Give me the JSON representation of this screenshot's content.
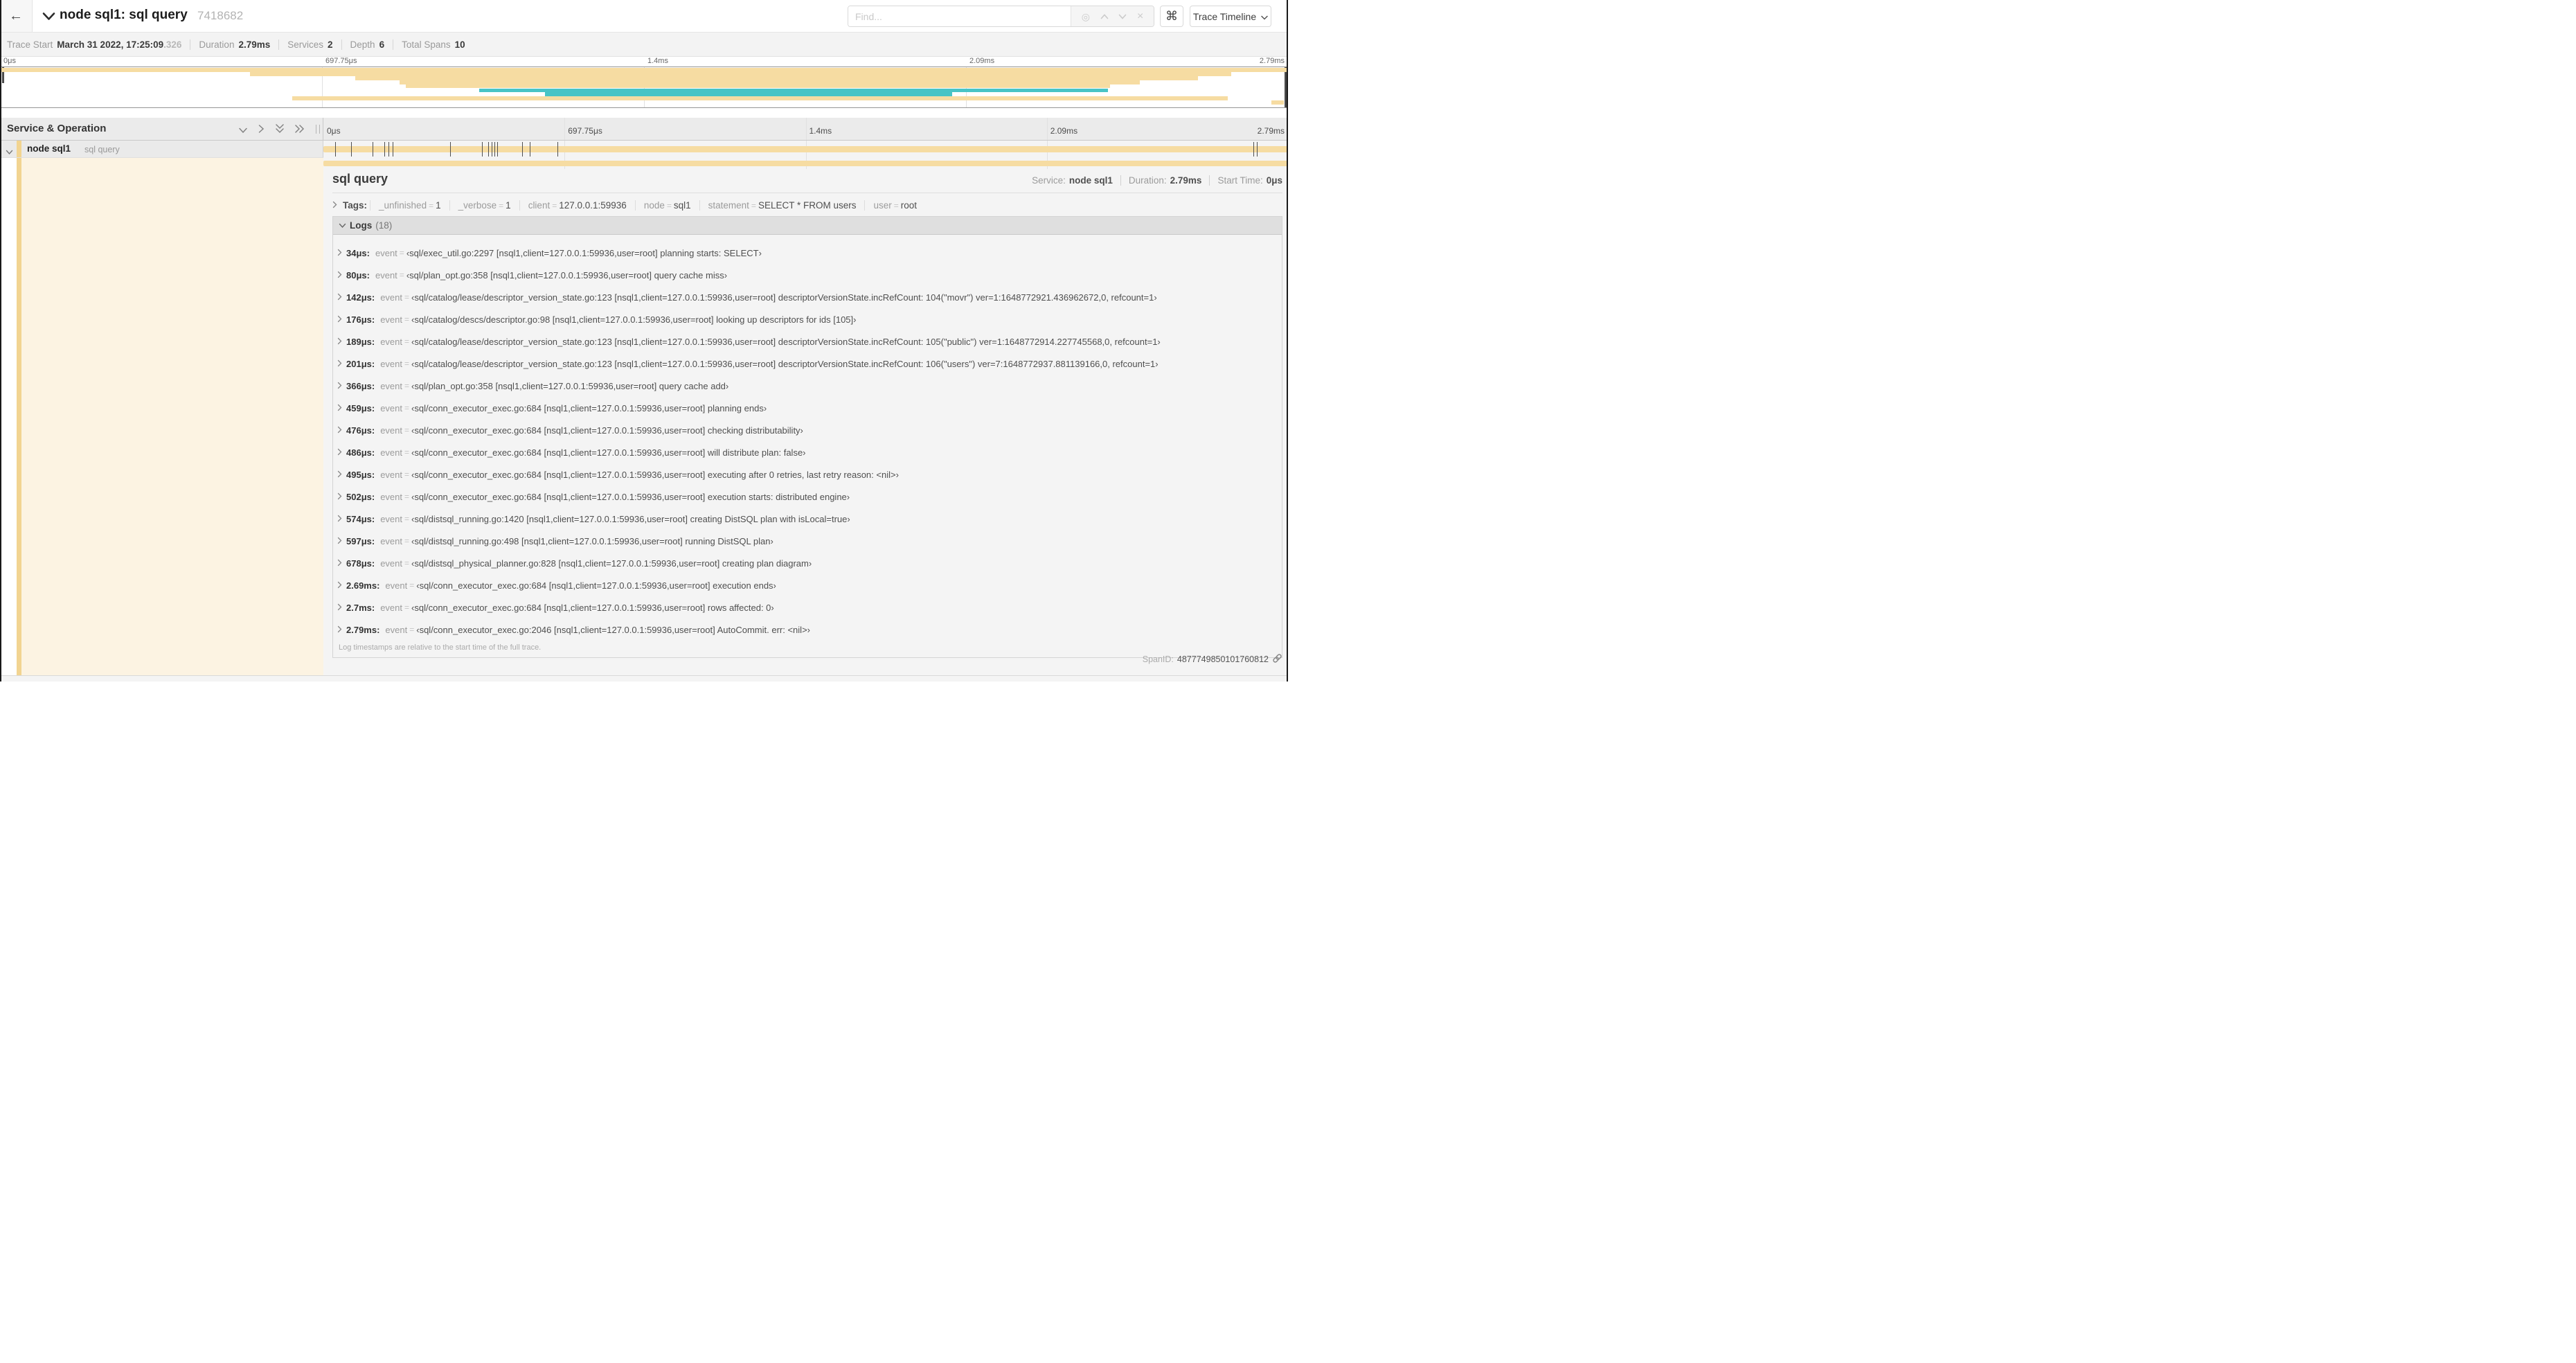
{
  "header": {
    "back_icon": "←",
    "title": "node sql1: sql query",
    "trace_id": "7418682",
    "find_placeholder": "Find...",
    "shortcuts_button": "⌘",
    "view_options_button": "Trace Timeline"
  },
  "summary": {
    "items": [
      {
        "label": "Trace Start",
        "value": "March 31 2022, 17:25:09",
        "suffix": ".326"
      },
      {
        "label": "Duration",
        "value": "2.79ms",
        "suffix": ""
      },
      {
        "label": "Services",
        "value": "2",
        "suffix": ""
      },
      {
        "label": "Depth",
        "value": "6",
        "suffix": ""
      },
      {
        "label": "Total Spans",
        "value": "10",
        "suffix": ""
      }
    ]
  },
  "colors": {
    "span_tan": "#f6dca2",
    "span_teal": "#48c4c6",
    "selected_row_cream": "#fcf3e2",
    "accent_stripe": "#f2d491"
  },
  "minimap": {
    "ticks": [
      "0μs",
      "697.75μs",
      "1.4ms",
      "2.09ms",
      "2.79ms"
    ],
    "spans": [
      {
        "start": 0.0,
        "end": 1.0,
        "color": "#f6dca2"
      },
      {
        "start": 0.194,
        "end": 0.956,
        "color": "#f6dca2"
      },
      {
        "start": 0.276,
        "end": 0.93,
        "color": "#f6dca2"
      },
      {
        "start": 0.31,
        "end": 0.885,
        "color": "#f6dca2"
      },
      {
        "start": 0.315,
        "end": 0.862,
        "color": "#f6dca2"
      },
      {
        "start": 0.372,
        "end": 0.86,
        "color": "#48c4c6"
      },
      {
        "start": 0.423,
        "end": 0.739,
        "color": "#48c4c6"
      },
      {
        "start": 0.227,
        "end": 0.953,
        "color": "#f6dca2"
      },
      {
        "start": 0.987,
        "end": 0.997,
        "color": "#f6dca2"
      }
    ]
  },
  "timeline": {
    "left_header": "Service & Operation",
    "ticks": [
      "0μs",
      "697.75μs",
      "1.4ms",
      "2.09ms",
      "2.79ms"
    ],
    "row": {
      "service": "node sql1",
      "operation": "sql query",
      "bar_start": 0,
      "bar_end": 1,
      "log_markers": [
        0.0122,
        0.0287,
        0.0509,
        0.0631,
        0.0677,
        0.072,
        0.1312,
        0.1645,
        0.1706,
        0.1742,
        0.1774,
        0.18,
        0.2057,
        0.214,
        0.243,
        0.9642,
        0.9677,
        0.999
      ]
    }
  },
  "detail": {
    "operation": "sql query",
    "overview": [
      {
        "label": "Service:",
        "value": "node sql1"
      },
      {
        "label": "Duration:",
        "value": "2.79ms"
      },
      {
        "label": "Start Time:",
        "value": "0μs"
      }
    ],
    "tags_label": "Tags:",
    "tags": [
      {
        "key": "_unfinished",
        "value": "1"
      },
      {
        "key": "_verbose",
        "value": "1"
      },
      {
        "key": "client",
        "value": "127.0.0.1:59936"
      },
      {
        "key": "node",
        "value": "sql1"
      },
      {
        "key": "statement",
        "value": "SELECT * FROM users"
      },
      {
        "key": "user",
        "value": "root"
      }
    ],
    "logs_label": "Logs",
    "logs_count": "(18)",
    "log_field": "event",
    "logs": [
      {
        "time": "34μs:",
        "value": "‹sql/exec_util.go:2297 [nsql1,client=127.0.0.1:59936,user=root] planning starts: SELECT›"
      },
      {
        "time": "80μs:",
        "value": "‹sql/plan_opt.go:358 [nsql1,client=127.0.0.1:59936,user=root] query cache miss›"
      },
      {
        "time": "142μs:",
        "value": "‹sql/catalog/lease/descriptor_version_state.go:123 [nsql1,client=127.0.0.1:59936,user=root] descriptorVersionState.incRefCount: 104(\"movr\") ver=1:1648772921.436962672,0, refcount=1›"
      },
      {
        "time": "176μs:",
        "value": "‹sql/catalog/descs/descriptor.go:98 [nsql1,client=127.0.0.1:59936,user=root] looking up descriptors for ids [105]›"
      },
      {
        "time": "189μs:",
        "value": "‹sql/catalog/lease/descriptor_version_state.go:123 [nsql1,client=127.0.0.1:59936,user=root] descriptorVersionState.incRefCount: 105(\"public\") ver=1:1648772914.227745568,0, refcount=1›"
      },
      {
        "time": "201μs:",
        "value": "‹sql/catalog/lease/descriptor_version_state.go:123 [nsql1,client=127.0.0.1:59936,user=root] descriptorVersionState.incRefCount: 106(\"users\") ver=7:1648772937.881139166,0, refcount=1›"
      },
      {
        "time": "366μs:",
        "value": "‹sql/plan_opt.go:358 [nsql1,client=127.0.0.1:59936,user=root] query cache add›"
      },
      {
        "time": "459μs:",
        "value": "‹sql/conn_executor_exec.go:684 [nsql1,client=127.0.0.1:59936,user=root] planning ends›"
      },
      {
        "time": "476μs:",
        "value": "‹sql/conn_executor_exec.go:684 [nsql1,client=127.0.0.1:59936,user=root] checking distributability›"
      },
      {
        "time": "486μs:",
        "value": "‹sql/conn_executor_exec.go:684 [nsql1,client=127.0.0.1:59936,user=root] will distribute plan: false›"
      },
      {
        "time": "495μs:",
        "value": "‹sql/conn_executor_exec.go:684 [nsql1,client=127.0.0.1:59936,user=root] executing after 0 retries, last retry reason: <nil>›"
      },
      {
        "time": "502μs:",
        "value": "‹sql/conn_executor_exec.go:684 [nsql1,client=127.0.0.1:59936,user=root] execution starts: distributed engine›"
      },
      {
        "time": "574μs:",
        "value": "‹sql/distsql_running.go:1420 [nsql1,client=127.0.0.1:59936,user=root] creating DistSQL plan with isLocal=true›"
      },
      {
        "time": "597μs:",
        "value": "‹sql/distsql_running.go:498 [nsql1,client=127.0.0.1:59936,user=root] running DistSQL plan›"
      },
      {
        "time": "678μs:",
        "value": "‹sql/distsql_physical_planner.go:828 [nsql1,client=127.0.0.1:59936,user=root] creating plan diagram›"
      },
      {
        "time": "2.69ms:",
        "value": "‹sql/conn_executor_exec.go:684 [nsql1,client=127.0.0.1:59936,user=root] execution ends›"
      },
      {
        "time": "2.7ms:",
        "value": "‹sql/conn_executor_exec.go:684 [nsql1,client=127.0.0.1:59936,user=root] rows affected: 0›"
      },
      {
        "time": "2.79ms:",
        "value": "‹sql/conn_executor_exec.go:2046 [nsql1,client=127.0.0.1:59936,user=root] AutoCommit. err: <nil>›"
      }
    ],
    "logs_footer": "Log timestamps are relative to the start time of the full trace.",
    "span_id_label": "SpanID:",
    "span_id": "4877749850101760812"
  }
}
